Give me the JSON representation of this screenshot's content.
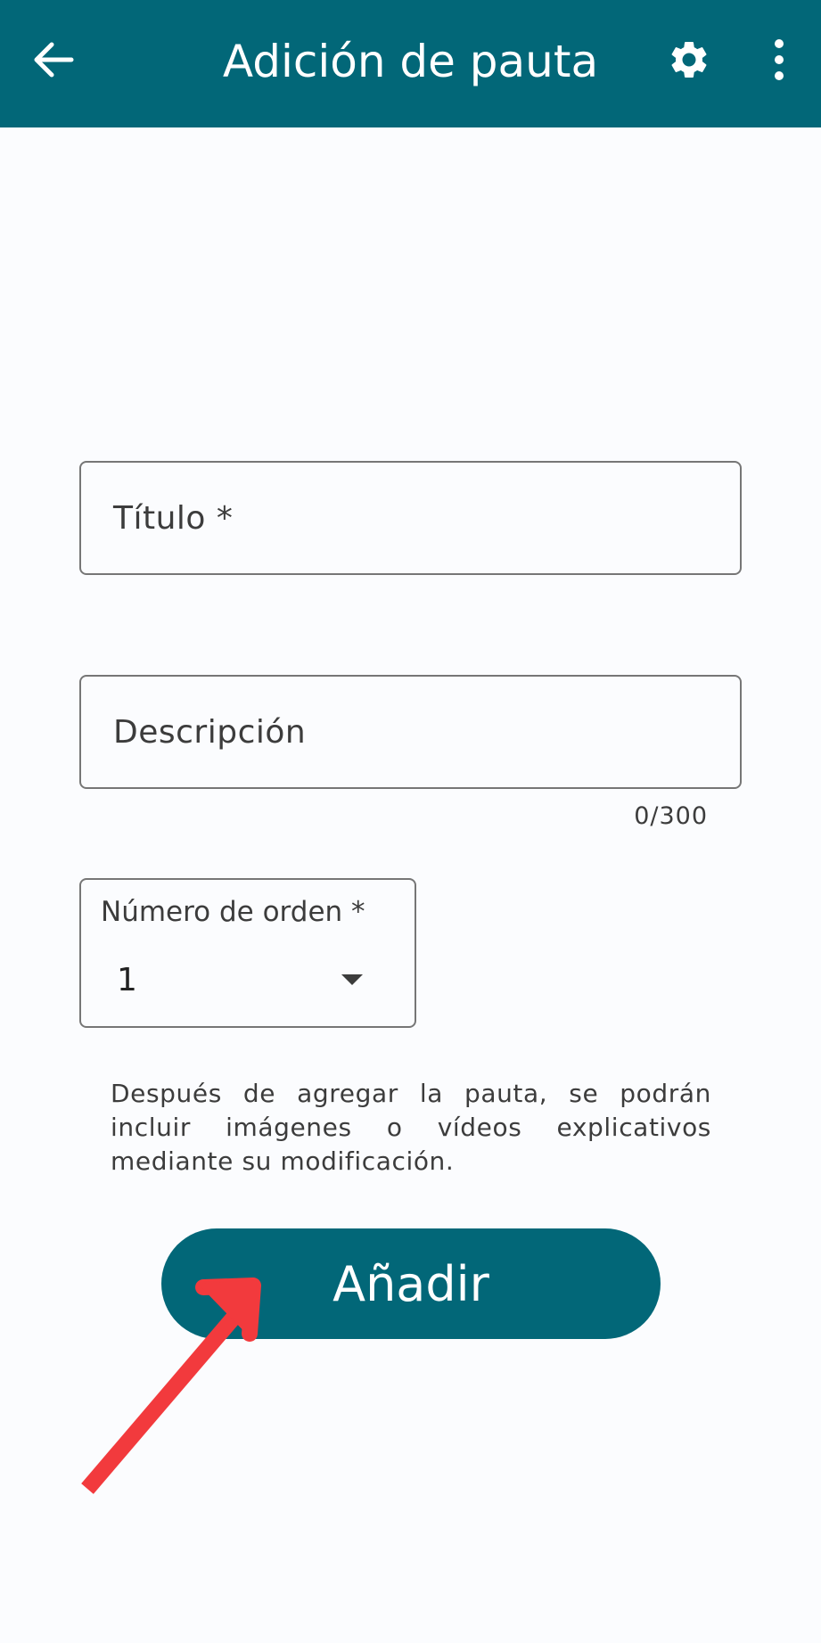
{
  "appbar": {
    "title": "Adición de pauta",
    "back_icon": "arrow-left-icon",
    "settings_icon": "gear-icon",
    "more_icon": "more-vert-icon",
    "color": "#026778"
  },
  "form": {
    "title_field": {
      "label": "Título *",
      "value": ""
    },
    "description_field": {
      "label": "Descripción",
      "value": "",
      "counter": "0/300"
    },
    "order_select": {
      "label": "Número de orden *",
      "selected": "1"
    },
    "hint": "Después de agregar la pauta, se podrán incluir imágenes o vídeos explicativos mediante su modificación.",
    "submit_label": "Añadir"
  },
  "annotation": {
    "type": "arrow",
    "color": "#f23a3d",
    "points_to": "submit-button"
  }
}
